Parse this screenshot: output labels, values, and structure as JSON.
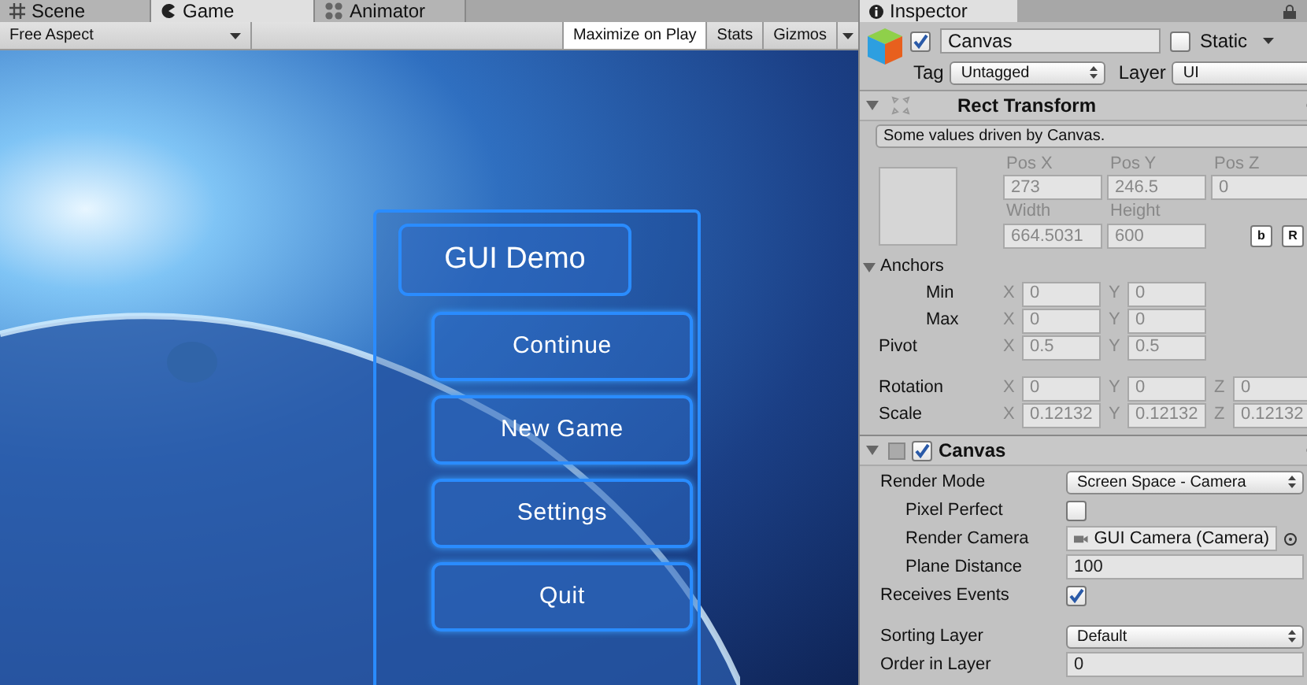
{
  "editor_tabs": [
    {
      "kind": "scene",
      "label": "Scene",
      "selected": false
    },
    {
      "kind": "game",
      "label": "Game",
      "selected": true
    },
    {
      "kind": "animator",
      "label": "Animator",
      "selected": false
    }
  ],
  "game_toolbar": {
    "aspect": "Free Aspect",
    "buttons": [
      {
        "label": "Maximize on Play",
        "selected": true
      },
      {
        "label": "Stats",
        "selected": false
      },
      {
        "label": "Gizmos",
        "selected": false
      }
    ]
  },
  "game_view": {
    "title": "GUI Demo",
    "menu": [
      "Continue",
      "New Game",
      "Settings",
      "Quit"
    ]
  },
  "inspector": {
    "title": "Inspector",
    "object": {
      "active": true,
      "name": "Canvas",
      "static_label": "Static",
      "static": false,
      "tag_label": "Tag",
      "tag": "Untagged",
      "layer_label": "Layer",
      "layer": "UI"
    },
    "rect_transform": {
      "title": "Rect Transform",
      "expanded": true,
      "disabled": true,
      "note": "Some values driven by Canvas.",
      "position": [
        {
          "label": "Pos X",
          "value": "273"
        },
        {
          "label": "Pos Y",
          "value": "246.5"
        },
        {
          "label": "Pos Z",
          "value": "0"
        }
      ],
      "size": [
        {
          "label": "Width",
          "value": "664.5031"
        },
        {
          "label": "Height",
          "value": "600"
        }
      ],
      "buttons": [
        "b",
        "R"
      ],
      "anchors": {
        "label": "Anchors",
        "expanded": true,
        "children": [
          {
            "label": "Min",
            "fields": [
              {
                "axis": "X",
                "value": "0"
              },
              {
                "axis": "Y",
                "value": "0"
              }
            ]
          },
          {
            "label": "Max",
            "fields": [
              {
                "axis": "X",
                "value": "0"
              },
              {
                "axis": "Y",
                "value": "0"
              }
            ]
          }
        ]
      },
      "pivot": {
        "label": "Pivot",
        "fields": [
          {
            "axis": "X",
            "value": "0.5"
          },
          {
            "axis": "Y",
            "value": "0.5"
          }
        ]
      },
      "rows": [
        {
          "label": "Rotation",
          "fields": [
            {
              "axis": "X",
              "value": "0"
            },
            {
              "axis": "Y",
              "value": "0"
            },
            {
              "axis": "Z",
              "value": "0"
            }
          ]
        },
        {
          "label": "Scale",
          "fields": [
            {
              "axis": "X",
              "value": "0.12132"
            },
            {
              "axis": "Y",
              "value": "0.12132"
            },
            {
              "axis": "Z",
              "value": "0.12132"
            }
          ]
        }
      ]
    },
    "canvas": {
      "title": "Canvas",
      "enabled": true,
      "expanded": true,
      "properties": [
        {
          "label": "Render Mode",
          "kind": "dropdown",
          "value": "Screen Space - Camera",
          "children": [
            {
              "label": "Pixel Perfect",
              "kind": "checkbox",
              "checked": false
            },
            {
              "label": "Render Camera",
              "kind": "object",
              "value": "GUI Camera (Camera)"
            },
            {
              "label": "Plane Distance",
              "kind": "number",
              "value": "100"
            }
          ]
        },
        {
          "label": "Receives Events",
          "kind": "checkbox",
          "checked": true
        }
      ],
      "sorting": [
        {
          "label": "Sorting Layer",
          "kind": "dropdown",
          "value": "Default"
        },
        {
          "label": "Order in Layer",
          "kind": "number",
          "value": "0"
        }
      ]
    }
  }
}
